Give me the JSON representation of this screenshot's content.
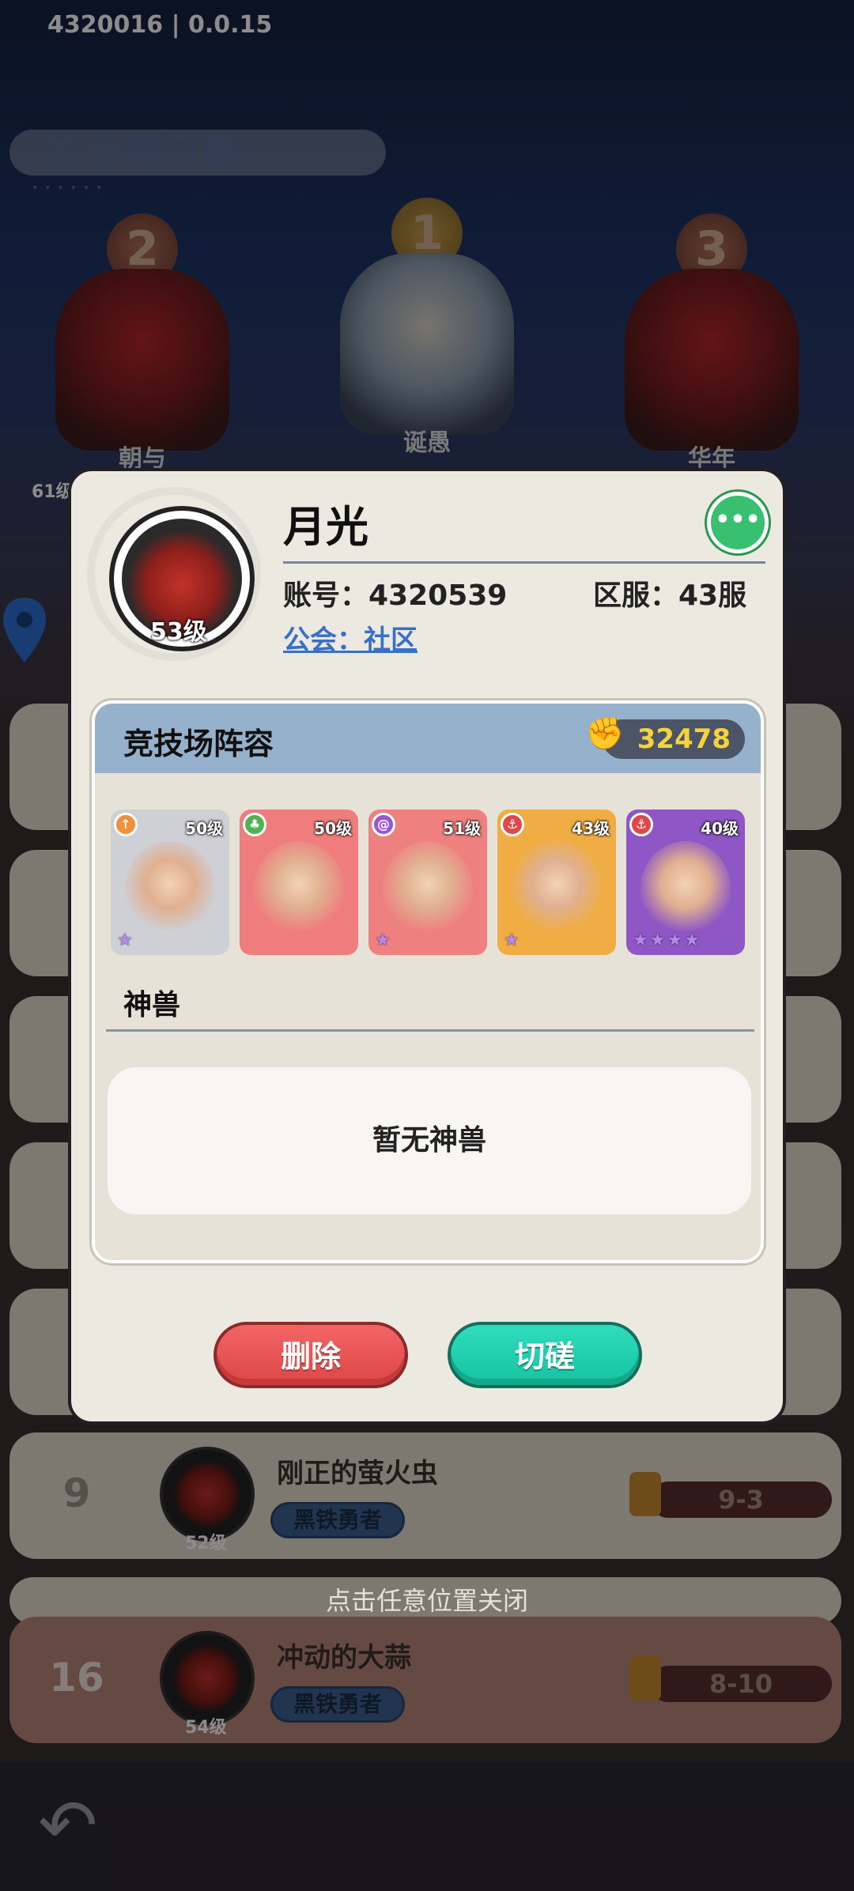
{
  "version": "4320016 | 0.0.15",
  "leaderboard": {
    "title": "关卡排行榜",
    "podium": [
      {
        "place": "2",
        "name": "朝与",
        "level": "61级"
      },
      {
        "place": "1",
        "name": "诞愚"
      },
      {
        "place": "3",
        "name": "华年"
      }
    ],
    "rows": [
      {
        "rank": "9",
        "name": "刚正的萤火虫",
        "title": "黑铁勇者",
        "level": "52级",
        "stage": "9-3"
      },
      {
        "rank": "16",
        "name": "冲动的大蒜",
        "title": "黑铁勇者",
        "level": "54级",
        "stage": "8-10"
      }
    ],
    "close_hint": "点击任意位置关闭"
  },
  "profile": {
    "name": "月光",
    "level": "53级",
    "account_label": "账号：4320539",
    "server_label": "区服：43服",
    "guild_label": "公会：社区",
    "chat_icon": "chat-bubble-icon"
  },
  "arena": {
    "title": "竞技场阵容",
    "power": "32478",
    "heroes": [
      {
        "level": "50级",
        "element": "arrow",
        "element_color": "#f0903a",
        "bg": "#cfcfd6",
        "stars": "★"
      },
      {
        "level": "50级",
        "element": "leaf",
        "element_color": "#4fb253",
        "bg": "#ef7d7d",
        "stars": ""
      },
      {
        "level": "51级",
        "element": "swirl",
        "element_color": "#9a55d6",
        "bg": "#ef8080",
        "stars": "★"
      },
      {
        "level": "43级",
        "element": "anchor",
        "element_color": "#e04848",
        "bg": "#f0ad43",
        "stars": "★"
      },
      {
        "level": "40级",
        "element": "anchor",
        "element_color": "#e04848",
        "bg": "#8e57c5",
        "stars": "★★★★"
      }
    ],
    "beast_label": "神兽",
    "beast_empty": "暂无神兽"
  },
  "buttons": {
    "delete": "删除",
    "spar": "切磋"
  },
  "colors": {
    "delete": "#ea5656",
    "spar": "#1fcfae",
    "panel_header": "#96b1cc",
    "guild_link": "#3a6fc9"
  }
}
